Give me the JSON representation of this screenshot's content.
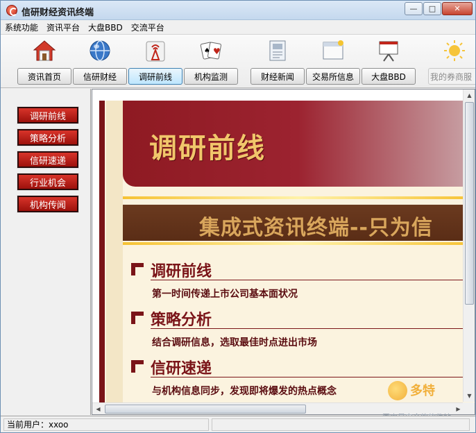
{
  "window": {
    "title": "信研财经资讯终端",
    "controls": {
      "minimize": "—",
      "maximize": "□",
      "close": "✕"
    }
  },
  "menubar": {
    "items": [
      "系统功能",
      "资讯平台",
      "大盘BBD",
      "交流平台"
    ]
  },
  "toolbar": {
    "items": [
      {
        "label": "资讯首页",
        "icon": "home-icon",
        "active": false
      },
      {
        "label": "信研财经",
        "icon": "globe-icon",
        "active": false
      },
      {
        "label": "调研前线",
        "icon": "antenna-icon",
        "active": true
      },
      {
        "label": "机构监测",
        "icon": "cards-icon",
        "active": false
      },
      {
        "label": "财经新闻",
        "icon": "news-icon",
        "active": false
      },
      {
        "label": "交易所信息",
        "icon": "window-icon",
        "active": false
      },
      {
        "label": "大盘BBD",
        "icon": "presentation-icon",
        "active": false
      },
      {
        "label": "我的券商服",
        "icon": "sun-icon",
        "active": false,
        "disabled": true
      }
    ]
  },
  "sidebar": {
    "items": [
      "调研前线",
      "策略分析",
      "信研速递",
      "行业机会",
      "机构传闻"
    ]
  },
  "content": {
    "banner_title": "调研前线",
    "slogan": "集成式资讯终端--只为信",
    "sections": [
      {
        "head": "调研前线",
        "desc": "第一时间传递上市公司基本面状况"
      },
      {
        "head": "策略分析",
        "desc": "结合调研信息，选取最佳时点进出市场"
      },
      {
        "head": "信研速递",
        "desc": "与机构信息同步，发现即将爆发的热点概念"
      }
    ]
  },
  "statusbar": {
    "user_label": "当前用户：xxoo"
  },
  "watermark": {
    "brand": "多特",
    "sub": "国内最安全的软件站"
  },
  "colors": {
    "accent_red": "#9d110c",
    "banner_red": "#8e1a22",
    "gold": "#f1c66b"
  }
}
